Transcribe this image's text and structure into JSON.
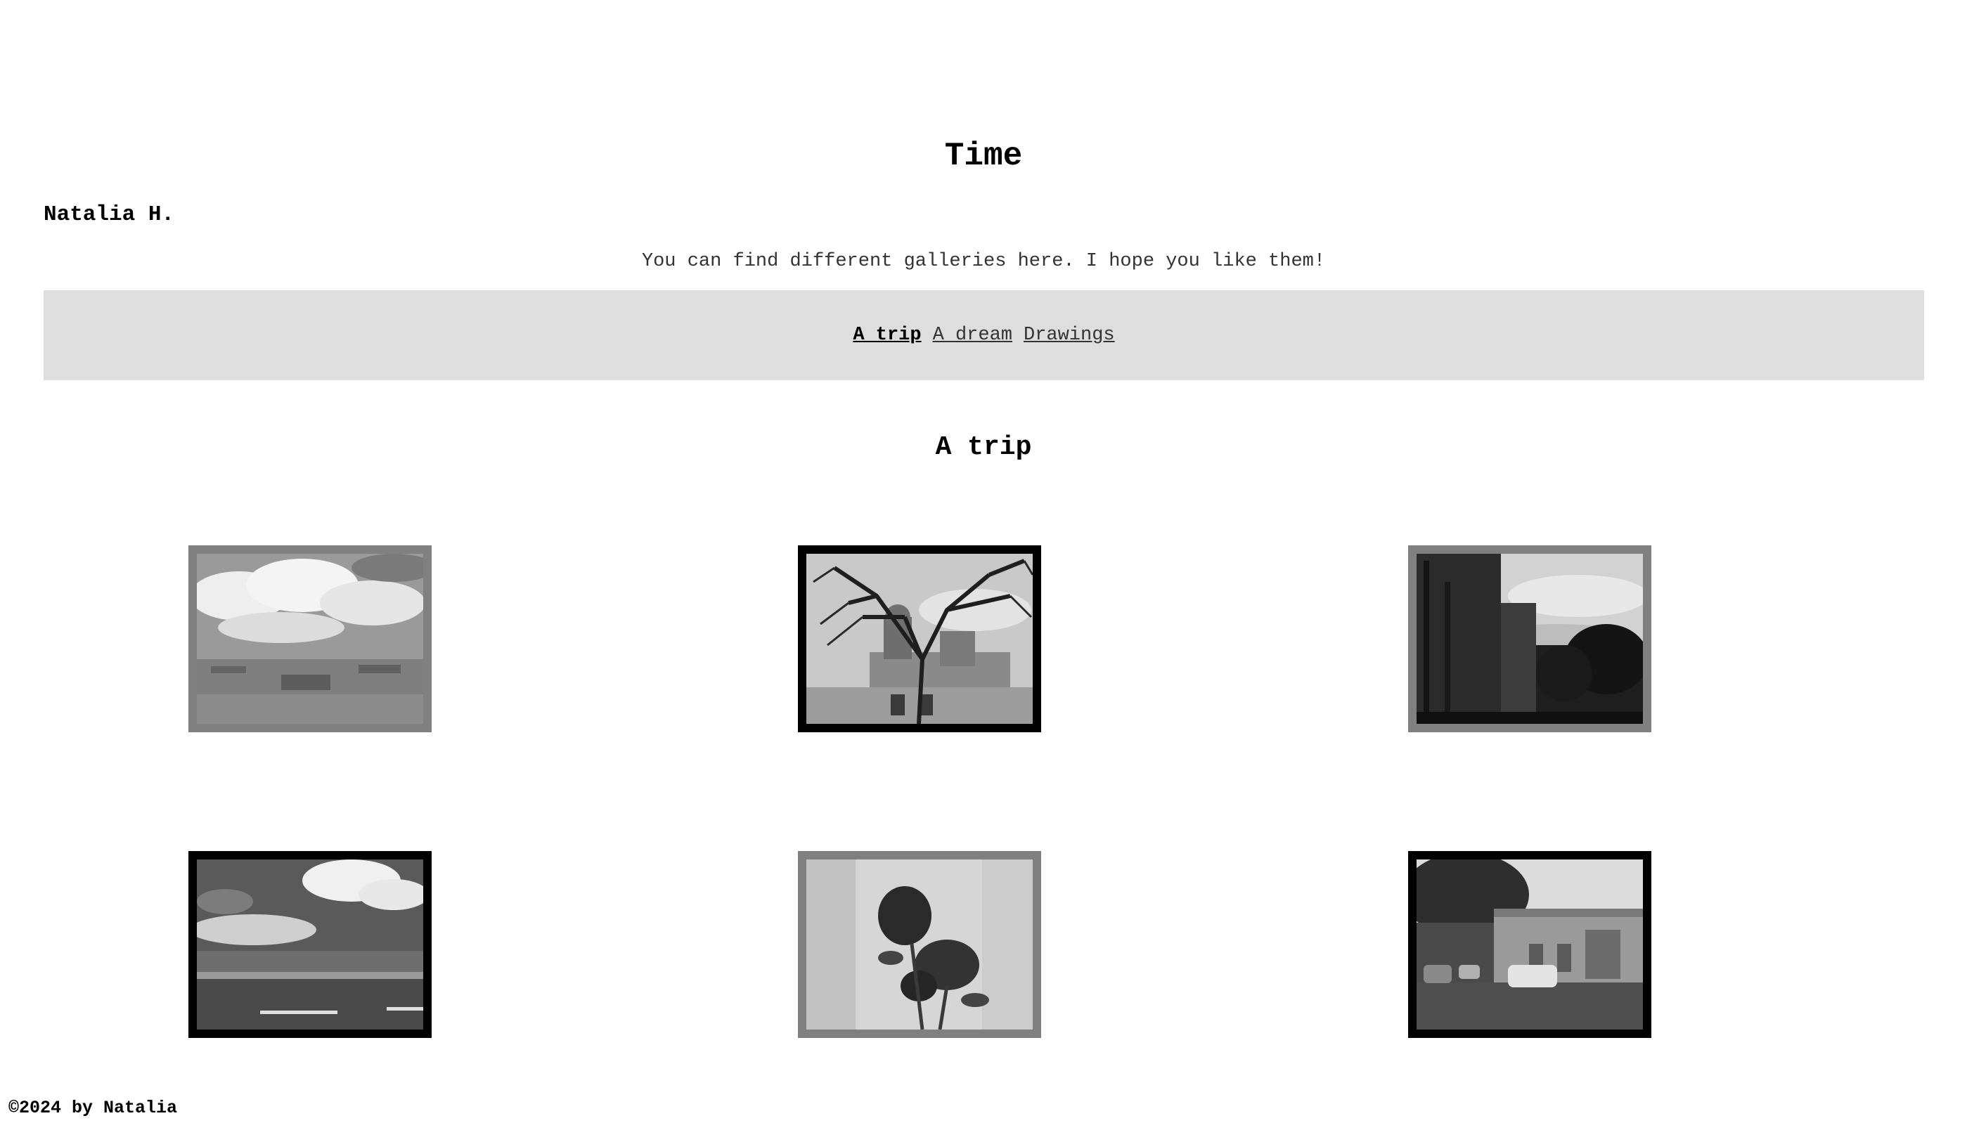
{
  "header": {
    "title": "Time",
    "author": "Natalia H.",
    "intro": "You can find different galleries here. I hope you like them!"
  },
  "nav": {
    "links": [
      {
        "label": "A trip",
        "active": true
      },
      {
        "label": "A dream",
        "active": false
      },
      {
        "label": "Drawings",
        "active": false
      }
    ]
  },
  "gallery": {
    "title": "A trip",
    "photos": [
      {
        "name": "cloudy-valley-ruins-photo",
        "frame": "grey"
      },
      {
        "name": "tree-and-church-photo",
        "frame": "black"
      },
      {
        "name": "street-with-buildings-photo",
        "frame": "grey"
      },
      {
        "name": "road-and-clouds-photo",
        "frame": "black"
      },
      {
        "name": "roses-photo",
        "frame": "grey"
      },
      {
        "name": "street-with-cars-photo",
        "frame": "black"
      }
    ]
  },
  "footer": {
    "text": "©2024 by Natalia"
  }
}
